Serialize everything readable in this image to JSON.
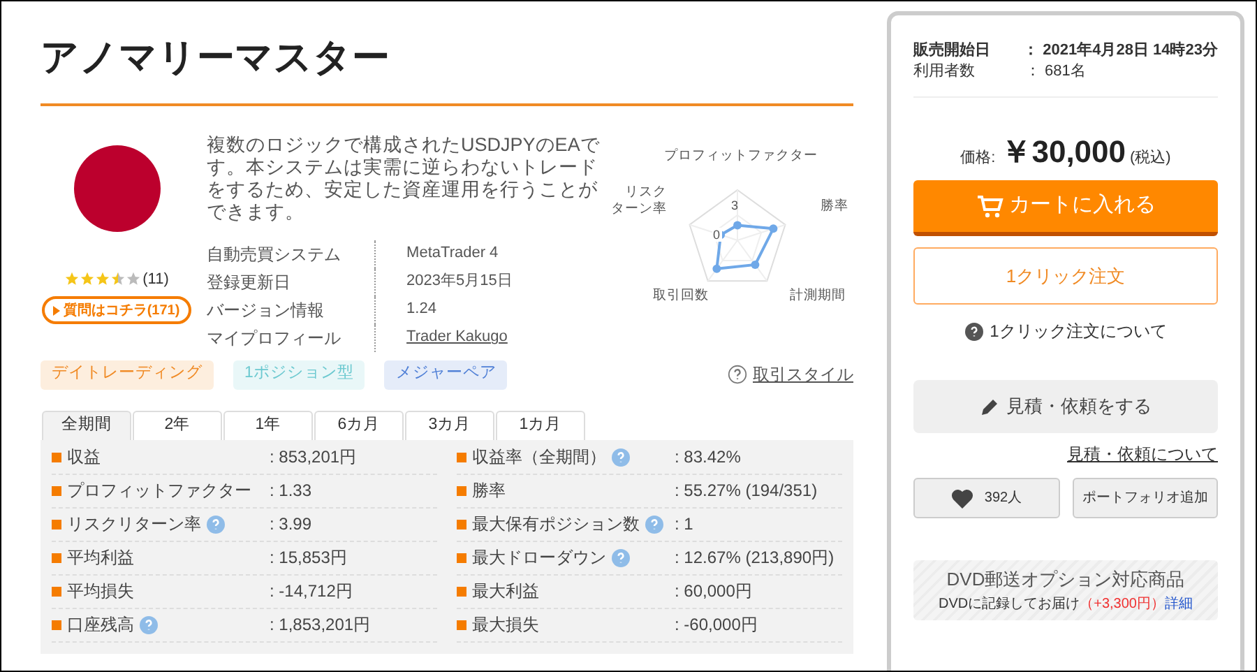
{
  "title": "アノマリーマスター",
  "description": "複数のロジックで構成されたUSDJPYのEAです。本システムは実需に逆らわないトレードをするため、安定した資産運用を行うことができます。",
  "rating": {
    "stars": 3.5,
    "count": "(11)"
  },
  "question_button": "質問はコチラ(171)",
  "specs": [
    {
      "label": "自動売買システム",
      "value": "MetaTrader 4",
      "kind": "text"
    },
    {
      "label": "登録更新日",
      "value": "2023年5月15日",
      "kind": "text"
    },
    {
      "label": "バージョン情報",
      "value": "1.24",
      "kind": "text"
    },
    {
      "label": "マイプロフィール",
      "value": "Trader Kakugo",
      "kind": "link"
    }
  ],
  "tags": [
    {
      "label": "デイトレーディング",
      "color": "#f08a24"
    },
    {
      "label": "1ポジション型",
      "color": "#6cc9d0"
    },
    {
      "label": "メジャーペア",
      "color": "#4f7fd6"
    }
  ],
  "radar": {
    "axes": [
      "プロフィットファクター",
      "勝率",
      "計測期間",
      "取引回数",
      [
        "リスク",
        "ターン率"
      ]
    ],
    "tick_labels": [
      "3",
      "0"
    ]
  },
  "style_link": "取引スタイル",
  "period_tabs": [
    {
      "label": "全期間",
      "selected": true
    },
    {
      "label": "2年",
      "selected": false
    },
    {
      "label": "1年",
      "selected": false
    },
    {
      "label": "6カ月",
      "selected": false
    },
    {
      "label": "3カ月",
      "selected": false
    },
    {
      "label": "1カ月",
      "selected": false
    }
  ],
  "stats_left": [
    {
      "label": "収益",
      "value": ": 853,201円",
      "help": false
    },
    {
      "label": "プロフィットファクター",
      "value": ": 1.33",
      "help": false
    },
    {
      "label": "リスクリターン率",
      "value": ": 3.99",
      "help": true
    },
    {
      "label": "平均利益",
      "value": ": 15,853円",
      "help": false
    },
    {
      "label": "平均損失",
      "value": ": -14,712円",
      "help": false
    },
    {
      "label": "口座残高",
      "value": ": 1,853,201円",
      "help": true
    }
  ],
  "stats_right": [
    {
      "label": "収益率（全期間）",
      "value": ": 83.42%",
      "help": true
    },
    {
      "label": "勝率",
      "value": ": 55.27% (194/351)",
      "help": false
    },
    {
      "label": "最大保有ポジション数",
      "value": ": 1",
      "help": true
    },
    {
      "label": "最大ドローダウン",
      "value": ": 12.67% (213,890円)",
      "help": true
    },
    {
      "label": "最大利益",
      "value": ": 60,000円",
      "help": false
    },
    {
      "label": "最大損失",
      "value": ": -60,000円",
      "help": false
    }
  ],
  "sidebar": {
    "info": [
      {
        "label": "販売開始日",
        "value": "： 2021年4月28日 14時23分",
        "bold": true
      },
      {
        "label": "利用者数",
        "value": "： 681名",
        "bold": false
      }
    ],
    "price_label": "価格:",
    "price": "￥30,000",
    "tax": "(税込)",
    "cart_button": "カートに入れる",
    "one_click_button": "1クリック注文",
    "one_click_help": "1クリック注文について",
    "estimate_button": "見積・依頼をする",
    "estimate_link": "見積・依頼について",
    "like_count": "392人",
    "portfolio_button": "ポートフォリオ追加",
    "dvd": {
      "title": "DVD郵送オプション対応商品",
      "note": "DVDに記録してお届け",
      "price": "（+3,300円）",
      "detail": "詳細"
    }
  }
}
